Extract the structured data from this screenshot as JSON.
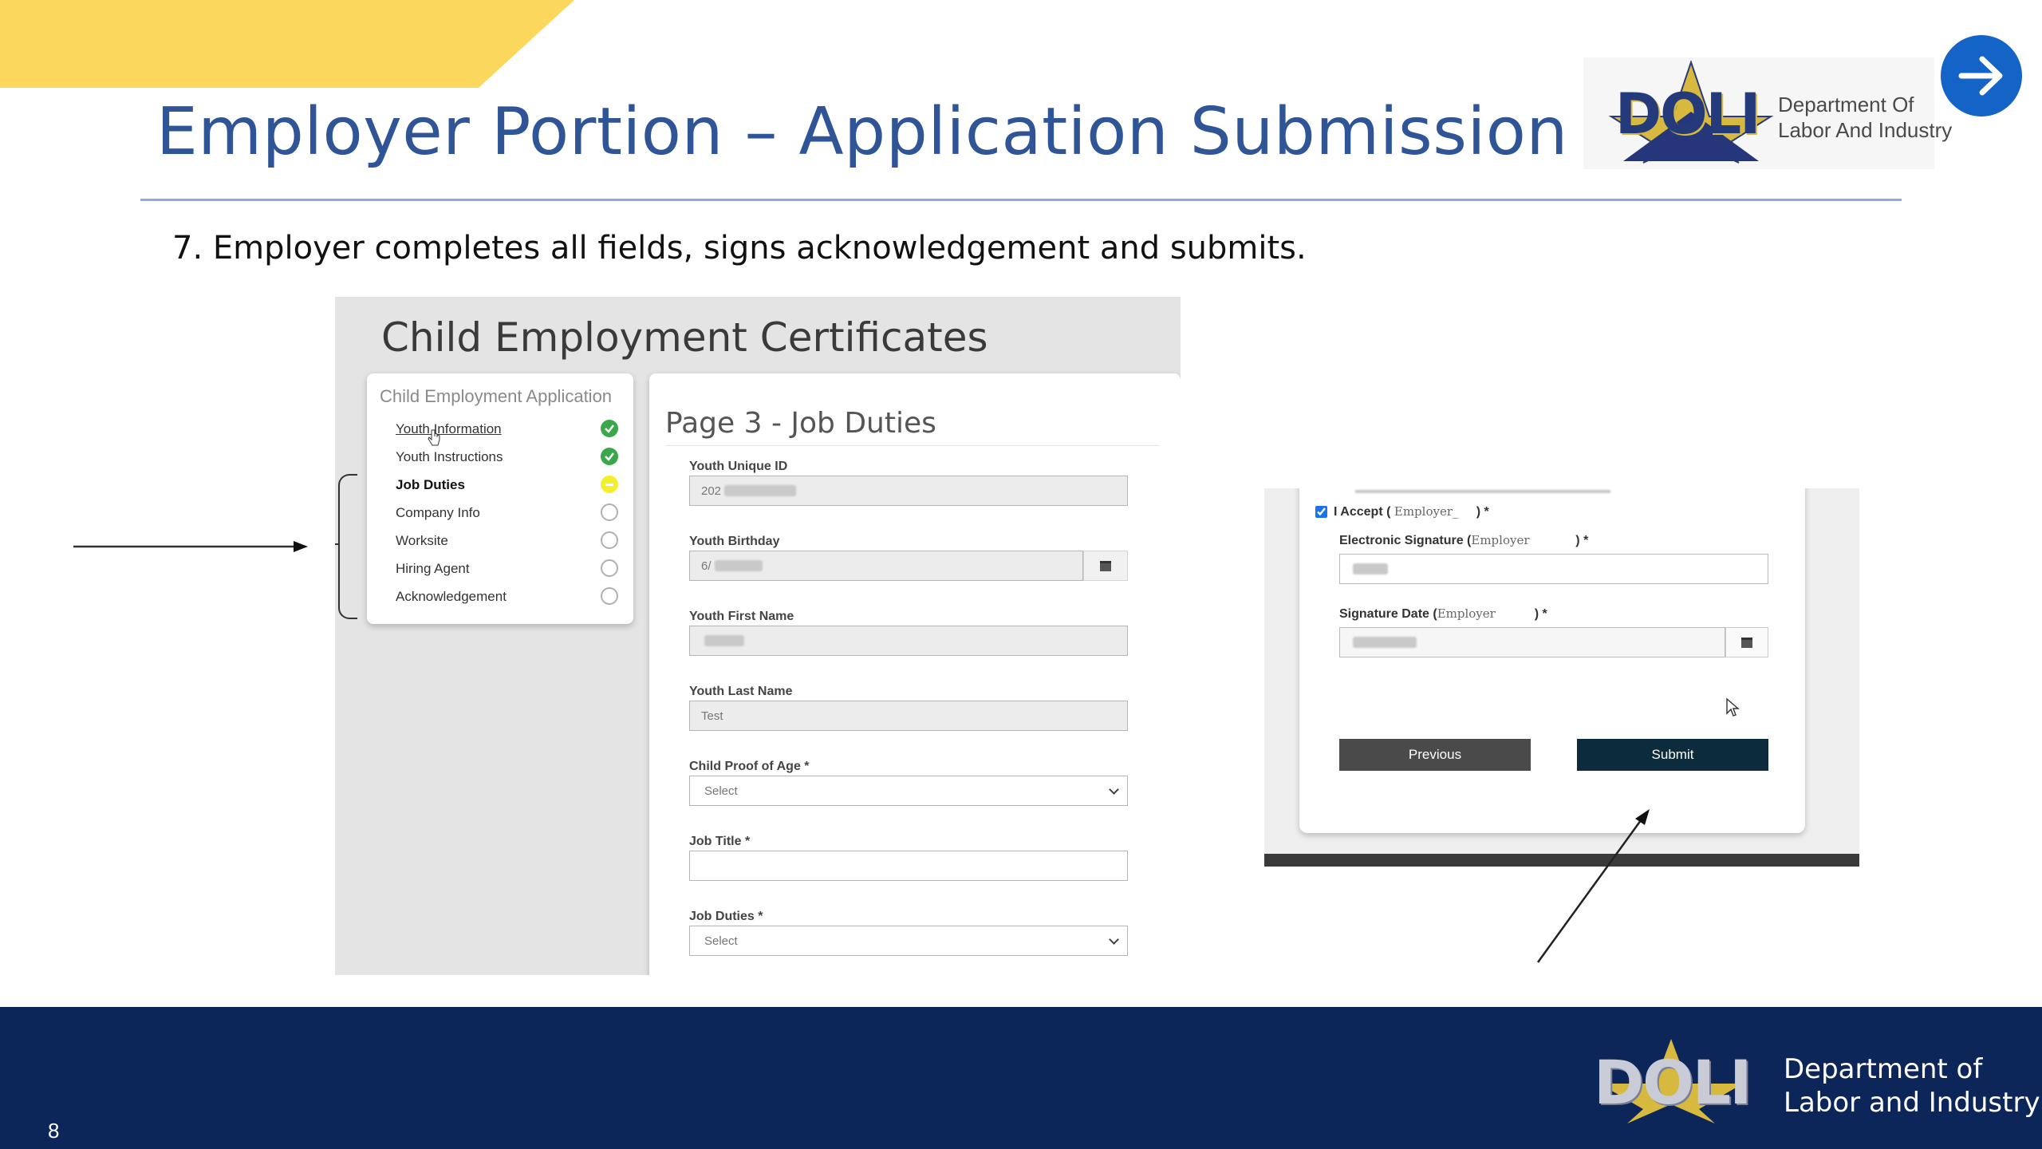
{
  "slide": {
    "title": "Employer Portion – Application Submission",
    "step": "7. Employer completes all fields, signs acknowledgement and submits.",
    "page_number": "8"
  },
  "logo": {
    "word": "DOLI",
    "top_line1": "Department Of",
    "top_line2": "Labor And Industry",
    "footer_line1": "Department of",
    "footer_line2": "Labor and Industry"
  },
  "colors": {
    "title": "#2f5597",
    "accent_band": "#fbd75b",
    "footer": "#0c2659",
    "next_button": "#1464c8"
  },
  "icons": {
    "next": "arrow-right-icon",
    "calendar": "calendar-icon",
    "cursor": "mouse-pointer-icon"
  },
  "screenshot_left": {
    "heading": "Child Employment Certificates",
    "nav": {
      "header": "Child Employment Application",
      "items": [
        {
          "label": "Youth Information",
          "status": "complete"
        },
        {
          "label": "Youth Instructions",
          "status": "complete"
        },
        {
          "label": "Job Duties",
          "status": "current"
        },
        {
          "label": "Company Info",
          "status": "incomplete"
        },
        {
          "label": "Worksite",
          "status": "incomplete"
        },
        {
          "label": "Hiring Agent",
          "status": "incomplete"
        },
        {
          "label": "Acknowledgement",
          "status": "incomplete"
        }
      ]
    },
    "form": {
      "heading": "Page 3 - Job Duties",
      "youth_unique_id": {
        "label": "Youth Unique ID",
        "value": "202"
      },
      "youth_birthday": {
        "label": "Youth Birthday",
        "value": "6/"
      },
      "youth_first_name": {
        "label": "Youth First Name",
        "value": ""
      },
      "youth_last_name": {
        "label": "Youth Last Name",
        "value": "Test"
      },
      "child_proof_of_age": {
        "label": "Child Proof of Age *",
        "value": "Select"
      },
      "job_title": {
        "label": "Job Title *",
        "value": ""
      },
      "job_duties": {
        "label": "Job Duties *",
        "value": "Select"
      }
    }
  },
  "screenshot_right": {
    "accept_label": "I Accept (",
    "accept_role": "Employer_",
    "accept_suffix": ") *",
    "accept_checked": true,
    "esig_label": "Electronic Signature (",
    "esig_role": "Employer",
    "esig_suffix": ") *",
    "sigdate_label": "Signature Date (",
    "sigdate_role": "Employer",
    "sigdate_suffix": ") *",
    "previous_label": "Previous",
    "submit_label": "Submit"
  }
}
